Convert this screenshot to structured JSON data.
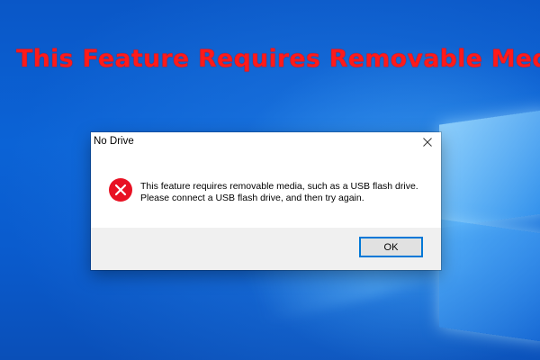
{
  "banner": {
    "title": "This Feature Requires Removable Media",
    "color": "#ff1a1a"
  },
  "dialog": {
    "title": "No Drive",
    "close_icon": "close-icon",
    "icon": "error-icon",
    "message_lines": [
      "This feature requires removable media, such as a USB flash drive.",
      "Please connect a USB flash drive, and then try again."
    ],
    "ok_label": "OK",
    "accent_color": "#0078d7",
    "error_color": "#e81123"
  }
}
